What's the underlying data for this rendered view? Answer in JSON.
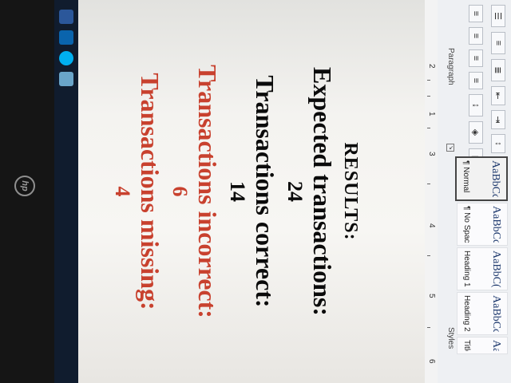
{
  "ribbon": {
    "paragraph_group_label": "Paragraph",
    "styles_group_label": "Styles",
    "launcher_glyph": "↘",
    "styles": [
      {
        "sample": "AaBbCcDc",
        "name": "¶ Normal",
        "selected": true
      },
      {
        "sample": "AaBbCcDc",
        "name": "¶ No Spac...",
        "selected": false
      },
      {
        "sample": "AaBbC(",
        "name": "Heading 1",
        "selected": false
      },
      {
        "sample": "AaBbCcE",
        "name": "Heading 2",
        "selected": false
      },
      {
        "sample": "Aal",
        "name": "Title",
        "selected": false
      }
    ]
  },
  "ruler": {
    "numbers": [
      "2",
      "1",
      "3",
      "4",
      "5",
      "6"
    ]
  },
  "document": {
    "heading": "RESULTS:",
    "expected_label": "Expected transactions:",
    "expected_value": "24",
    "correct_label": "Transactions correct:",
    "correct_value": "14",
    "incorrect_label": "Transactions incorrect:",
    "incorrect_value": "6",
    "missing_label": "Transactions missing:",
    "missing_value": "4",
    "highlight_color": "#c8412e"
  },
  "taskbar": {
    "icons": [
      {
        "name": "word-icon",
        "color": "#2b579a"
      },
      {
        "name": "outlook-icon",
        "color": "#0a64ad"
      },
      {
        "name": "skype-icon",
        "color": "#00aff0"
      },
      {
        "name": "app-icon",
        "color": "#6aa5c9"
      }
    ]
  },
  "device": {
    "logo": "hp"
  }
}
